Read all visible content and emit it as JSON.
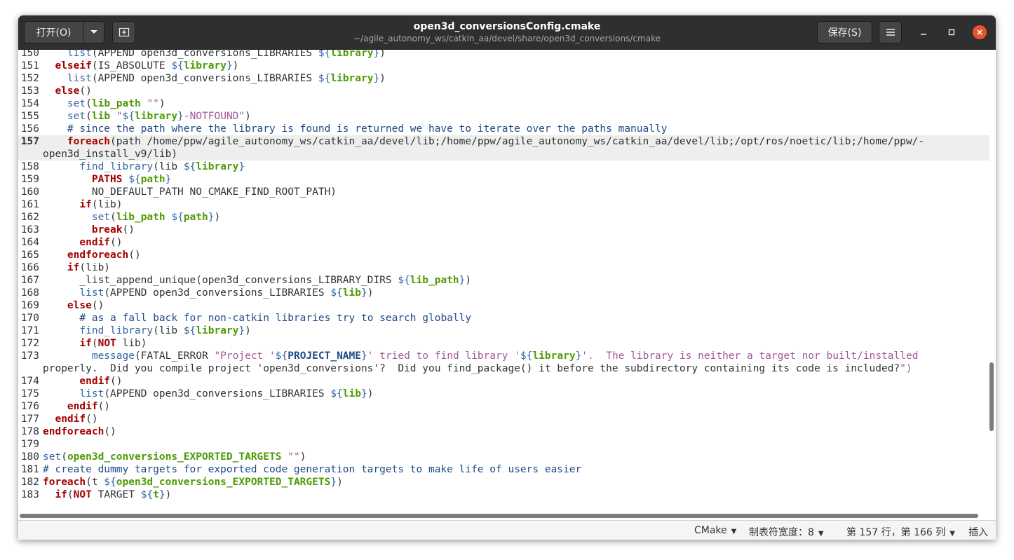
{
  "titlebar": {
    "open_label": "打开(O)",
    "title": "open3d_conversionsConfig.cmake",
    "subtitle": "~/agile_autonomy_ws/catkin_aa/devel/share/open3d_conversions/cmake",
    "save_label": "保存(S)"
  },
  "statusbar": {
    "language": "CMake",
    "tab_width": "制表符宽度：8",
    "cursor_position": "第 157 行，第 166 列",
    "insert_mode": "插入"
  },
  "editor": {
    "current_line": 157,
    "lines": [
      {
        "n": "150",
        "t": "    list(APPEND open3d_conversions_LIBRARIES ${library})"
      },
      {
        "n": "151",
        "t": "  elseif(IS_ABSOLUTE ${library})"
      },
      {
        "n": "152",
        "t": "    list(APPEND open3d_conversions_LIBRARIES ${library})"
      },
      {
        "n": "153",
        "t": "  else()"
      },
      {
        "n": "154",
        "t": "    set(lib_path \"\")"
      },
      {
        "n": "155",
        "t": "    set(lib \"${library}-NOTFOUND\")"
      },
      {
        "n": "156",
        "t": "    # since the path where the library is found is returned we have to iterate over the paths manually"
      },
      {
        "n": "157",
        "t": "    foreach(path /home/ppw/agile_autonomy_ws/catkin_aa/devel/lib;/home/ppw/agile_autonomy_ws/catkin_aa/devel/lib;/opt/ros/noetic/lib;/home/ppw/-",
        "t2": "open3d_install_v9/lib)"
      },
      {
        "n": "158",
        "t": "      find_library(lib ${library}"
      },
      {
        "n": "159",
        "t": "        PATHS ${path}"
      },
      {
        "n": "160",
        "t": "        NO_DEFAULT_PATH NO_CMAKE_FIND_ROOT_PATH)"
      },
      {
        "n": "161",
        "t": "      if(lib)"
      },
      {
        "n": "162",
        "t": "        set(lib_path ${path})"
      },
      {
        "n": "163",
        "t": "        break()"
      },
      {
        "n": "164",
        "t": "      endif()"
      },
      {
        "n": "165",
        "t": "    endforeach()"
      },
      {
        "n": "166",
        "t": "    if(lib)"
      },
      {
        "n": "167",
        "t": "      _list_append_unique(open3d_conversions_LIBRARY_DIRS ${lib_path})"
      },
      {
        "n": "168",
        "t": "      list(APPEND open3d_conversions_LIBRARIES ${lib})"
      },
      {
        "n": "169",
        "t": "    else()"
      },
      {
        "n": "170",
        "t": "      # as a fall back for non-catkin libraries try to search globally"
      },
      {
        "n": "171",
        "t": "      find_library(lib ${library})"
      },
      {
        "n": "172",
        "t": "      if(NOT lib)"
      },
      {
        "n": "173",
        "t": "        message(FATAL_ERROR \"Project '${PROJECT_NAME}' tried to find library '${library}'.  The library is neither a target nor built/installed",
        "t2": "properly.  Did you compile project 'open3d_conversions'?  Did you find_package() it before the subdirectory containing its code is included?\")"
      },
      {
        "n": "174",
        "t": "      endif()"
      },
      {
        "n": "175",
        "t": "      list(APPEND open3d_conversions_LIBRARIES ${lib})"
      },
      {
        "n": "176",
        "t": "    endif()"
      },
      {
        "n": "177",
        "t": "  endif()"
      },
      {
        "n": "178",
        "t": "endforeach()"
      },
      {
        "n": "179",
        "t": ""
      },
      {
        "n": "180",
        "t": "set(open3d_conversions_EXPORTED_TARGETS \"\")"
      },
      {
        "n": "181",
        "t": "# create dummy targets for exported code generation targets to make life of users easier"
      },
      {
        "n": "182",
        "t": "foreach(t ${open3d_conversions_EXPORTED_TARGETS})"
      },
      {
        "n": "183",
        "t": "  if(NOT TARGET ${t})"
      }
    ]
  }
}
